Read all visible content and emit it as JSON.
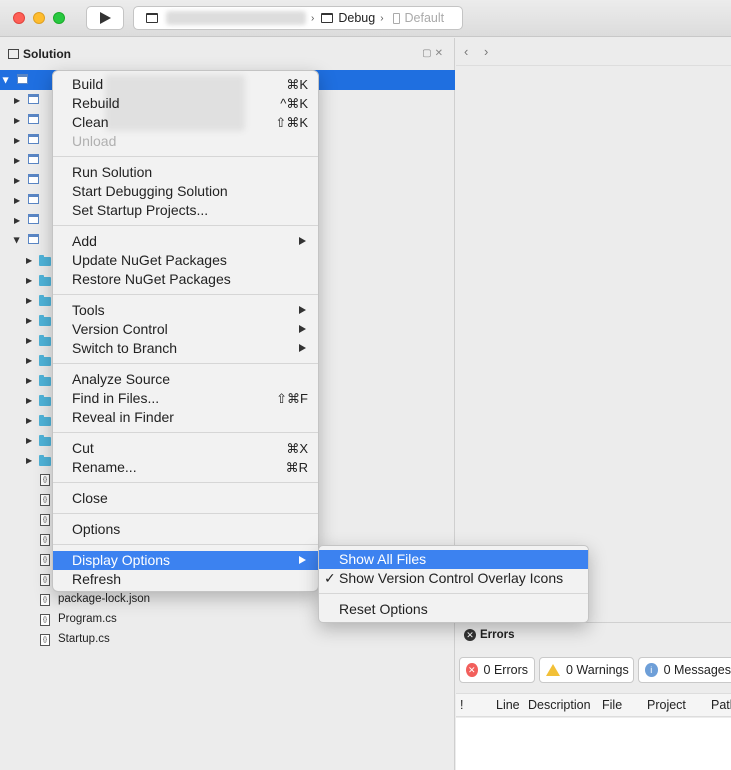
{
  "toolbar": {
    "config": "Debug",
    "device": "Default"
  },
  "solution_pane": {
    "title": "Solution",
    "files": [
      "package-lock.json",
      "Program.cs",
      "Startup.cs"
    ]
  },
  "context_menu": {
    "items": [
      {
        "label": "Build",
        "shortcut": "⌘K"
      },
      {
        "label": "Rebuild",
        "shortcut": "^⌘K"
      },
      {
        "label": "Clean",
        "shortcut": "⇧⌘K"
      },
      {
        "label": "Unload",
        "shortcut": ""
      },
      {
        "label": "Run Solution",
        "shortcut": ""
      },
      {
        "label": "Start Debugging Solution",
        "shortcut": ""
      },
      {
        "label": "Set Startup Projects...",
        "shortcut": ""
      },
      {
        "label": "Add",
        "shortcut": ""
      },
      {
        "label": "Update NuGet Packages",
        "shortcut": ""
      },
      {
        "label": "Restore NuGet Packages",
        "shortcut": ""
      },
      {
        "label": "Tools",
        "shortcut": ""
      },
      {
        "label": "Version Control",
        "shortcut": ""
      },
      {
        "label": "Switch to Branch",
        "shortcut": ""
      },
      {
        "label": "Analyze Source",
        "shortcut": ""
      },
      {
        "label": "Find in Files...",
        "shortcut": "⇧⌘F"
      },
      {
        "label": "Reveal in Finder",
        "shortcut": ""
      },
      {
        "label": "Cut",
        "shortcut": "⌘X"
      },
      {
        "label": "Rename...",
        "shortcut": "⌘R"
      },
      {
        "label": "Close",
        "shortcut": ""
      },
      {
        "label": "Options",
        "shortcut": ""
      },
      {
        "label": "Display Options",
        "shortcut": ""
      },
      {
        "label": "Refresh",
        "shortcut": ""
      }
    ]
  },
  "display_options_submenu": {
    "items": [
      {
        "label": "Show All Files"
      },
      {
        "label": "Show Version Control Overlay Icons",
        "check": "✓"
      },
      {
        "label": "Reset Options"
      }
    ]
  },
  "errors_pane": {
    "title": "Errors",
    "errors_btn": "0 Errors",
    "warnings_btn": "0 Warnings",
    "messages_btn": "0 Messages",
    "columns": [
      "!",
      "Line",
      "Description",
      "File",
      "Project",
      "Path"
    ]
  }
}
